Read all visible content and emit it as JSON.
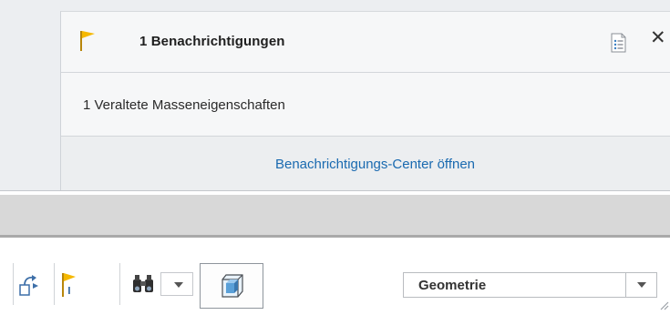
{
  "notification_popup": {
    "title": "1 Benachrichtigungen",
    "items": [
      {
        "label": "1 Veraltete Masseneigenschaften"
      }
    ],
    "footer_link": "Benachrichtigungs-Center öffnen",
    "close_glyph": "✕",
    "icons": {
      "flag": "flag-icon",
      "details": "details-list-icon",
      "close": "close-icon"
    }
  },
  "toolbar": {
    "icons": [
      "regenerate-arrow-icon",
      "notification-flag-icon",
      "binoculars-find-icon",
      "cube-view-icon"
    ],
    "filter_select": {
      "selected": "Geometrie"
    }
  },
  "colors": {
    "accent_link": "#1a6ab0",
    "flag": "#f5b800",
    "panel_background": "#f6f7f8"
  }
}
